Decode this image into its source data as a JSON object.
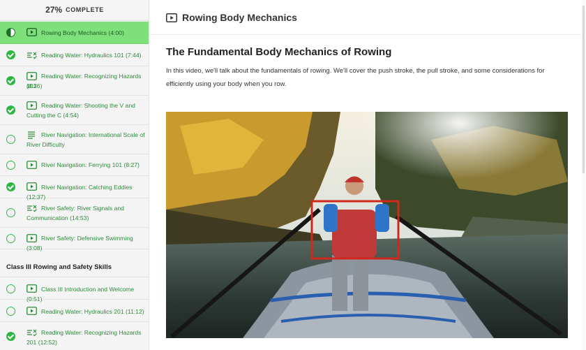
{
  "progress": {
    "percent": "27%",
    "label": "COMPLETE"
  },
  "sidebar": {
    "section_title": "Class III Rowing and Safety Skills",
    "items": [
      {
        "title": "Rowing Body Mechanics (4:00)",
        "type": "video-icon",
        "status": "in-progress"
      },
      {
        "title": "Reading Water: Hydraulics 101 (7:44)",
        "type": "quiz-icon",
        "status": "complete"
      },
      {
        "title_line1": "Reading Water: Recognizing Hazards 101",
        "title_line2": "(8:36)",
        "type": "video-icon",
        "status": "complete"
      },
      {
        "title_line1": "Reading Water: Shooting the V and",
        "title_line2": "Cutting the C (4:54)",
        "type": "video-icon",
        "status": "complete"
      },
      {
        "title_line1": "River Navigation: International Scale of",
        "title_line2": "River Difficulty",
        "type": "text-icon",
        "status": "incomplete"
      },
      {
        "title": "River Navigation: Ferrying 101 (8:27)",
        "type": "video-icon",
        "status": "incomplete"
      },
      {
        "title": "River Navigation: Catching Eddies (12:37)",
        "type": "video-icon",
        "status": "complete"
      },
      {
        "title_line1": "River Safety: River Signals and",
        "title_line2": "Communication (14:53)",
        "type": "quiz-icon",
        "status": "incomplete"
      },
      {
        "title": "River Safety: Defensive Swimming (3:08)",
        "type": "video-icon",
        "status": "incomplete"
      },
      {
        "title": "Class III Introduction and Welcome (0:51)",
        "type": "video-icon",
        "status": "incomplete"
      },
      {
        "title": "Reading Water: Hydraulics 201 (11:12)",
        "type": "video-icon",
        "status": "incomplete"
      },
      {
        "title_line1": "Reading Water: Recognizing Hazards",
        "title_line2": "201 (12:52)",
        "type": "quiz-icon",
        "status": "complete"
      }
    ]
  },
  "main": {
    "lesson_title": "Rowing Body Mechanics",
    "headline": "The Fundamental Body Mechanics of Rowing",
    "intro": "In this video, we'll talk about the fundamentals of rowing. We'll cover the push stroke, the pull stroke, and some considerations for efficiently using your body when you row."
  },
  "colors": {
    "accent_green": "#2db742",
    "active_row": "#7ee07a",
    "highlight_box": "#d0281c"
  }
}
